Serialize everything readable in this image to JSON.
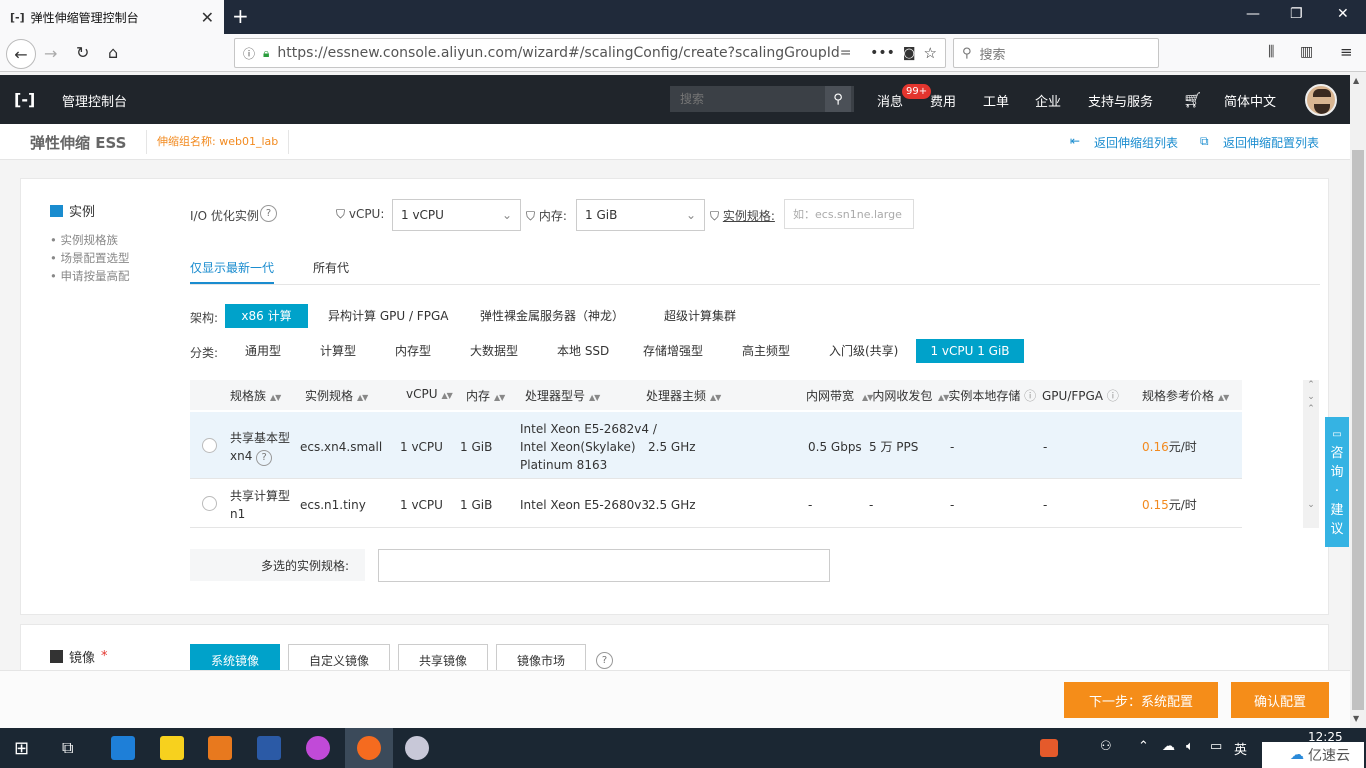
{
  "browser": {
    "tab_title": "弹性伸缩管理控制台",
    "tab_close": "✕",
    "new_tab": "+",
    "url": "https://essnew.console.aliyun.com/wizard#/scalingConfig/create?scalingGroupId=",
    "search_placeholder": "搜索"
  },
  "header": {
    "console_title": "管理控制台",
    "search_placeholder": "搜索",
    "links": [
      "消息",
      "费用",
      "工单",
      "企业",
      "支持与服务",
      "简体中文"
    ],
    "badge": "99+"
  },
  "subheader": {
    "title": "弹性伸缩 ESS",
    "group_name": "伸缩组名称: web01_lab",
    "back_list": "返回伸缩组列表",
    "back_config": "返回伸缩配置列表"
  },
  "instance": {
    "section_title": "实例",
    "side_items": [
      "实例规格族",
      "场景配置选型",
      "申请按量高配"
    ],
    "io_label": "I/O 优化实例",
    "vcpu_label": "vCPU:",
    "vcpu_value": "1 vCPU",
    "mem_label": "内存:",
    "mem_value": "1 GiB",
    "spec_label": "实例规格:",
    "spec_placeholder": "如：ecs.sn1ne.large",
    "generations": [
      "仅显示最新一代",
      "所有代"
    ],
    "arch_label": "架构:",
    "arch_options": [
      "x86 计算",
      "异构计算 GPU / FPGA",
      "弹性裸金属服务器（神龙）",
      "超级计算集群"
    ],
    "cat_label": "分类:",
    "cat_options": [
      "通用型",
      "计算型",
      "内存型",
      "大数据型",
      "本地 SSD",
      "存储增强型",
      "高主频型",
      "入门级(共享)",
      "1 vCPU 1 GiB"
    ],
    "columns": [
      "规格族",
      "实例规格",
      "vCPU",
      "内存",
      "处理器型号",
      "处理器主频",
      "内网带宽",
      "内网收发包",
      "实例本地存储",
      "GPU/FPGA",
      "规格参考价格"
    ],
    "rows": [
      {
        "family": "共享基本型",
        "family2": "xn4",
        "spec": "ecs.xn4.small",
        "vcpu": "1 vCPU",
        "mem": "1 GiB",
        "cpu1": "Intel Xeon E5-2682v4 /",
        "cpu2": "Intel Xeon(Skylake)",
        "cpu3": "Platinum 8163",
        "freq": "2.5 GHz",
        "bw": "0.5 Gbps",
        "pps": "5 万 PPS",
        "storage": "-",
        "gpu": "-",
        "price": "0.16",
        "unit": "元/时"
      },
      {
        "family": "共享计算型",
        "family2": "n1",
        "spec": "ecs.n1.tiny",
        "vcpu": "1 vCPU",
        "mem": "1 GiB",
        "cpu1": "Intel Xeon E5-2680v3",
        "cpu2": "",
        "cpu3": "",
        "freq": "2.5 GHz",
        "bw": "-",
        "pps": "-",
        "storage": "-",
        "gpu": "-",
        "price": "0.15",
        "unit": "元/时"
      }
    ],
    "multi_label": "多选的实例规格:"
  },
  "image": {
    "section_title": "镜像",
    "required_mark": "*",
    "tabs": [
      "系统镜像",
      "自定义镜像",
      "共享镜像",
      "镜像市场"
    ]
  },
  "footer": {
    "next": "下一步：系统配置",
    "confirm": "确认配置"
  },
  "consult": [
    "咨",
    "询",
    "·",
    "建",
    "议"
  ],
  "taskbar": {
    "time": "12:25",
    "ime": "英",
    "watermark": "亿速云"
  },
  "colors": {
    "accent": "#00a2ca",
    "orange": "#f58d19",
    "link": "#1a8ccf"
  }
}
